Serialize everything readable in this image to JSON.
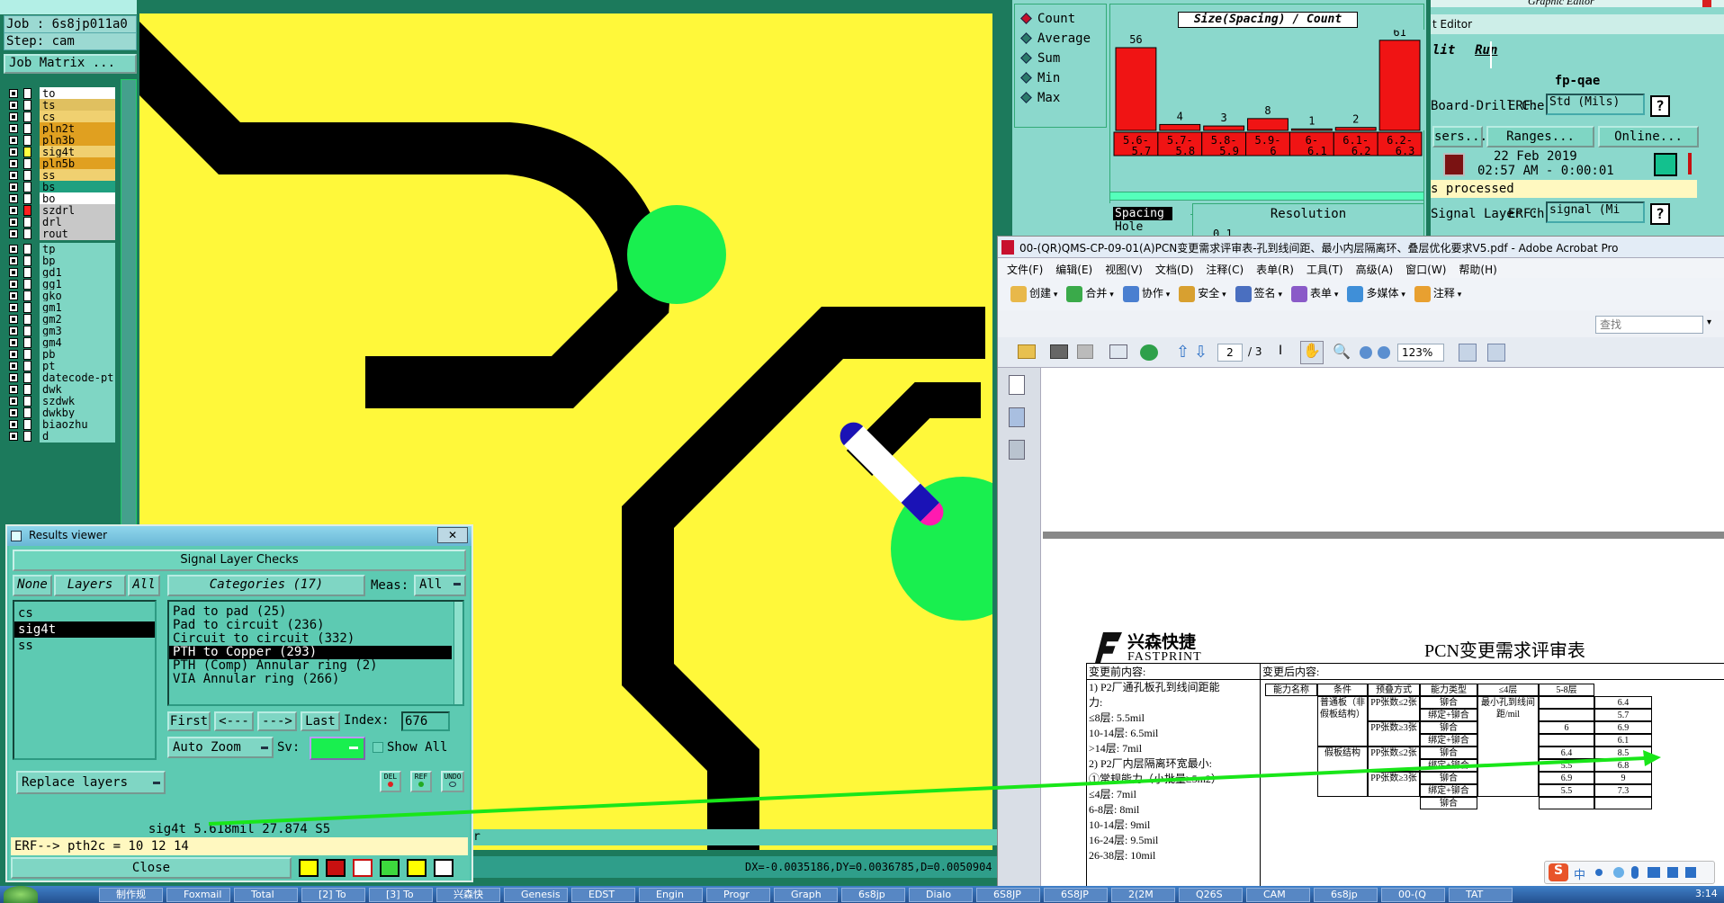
{
  "left": {
    "job": "Job : 6s8jp011a0",
    "step": "Step: cam",
    "matrix_button": "Job Matrix ...",
    "layers": [
      {
        "name": "to",
        "color": "#ffffff",
        "swatch": "#ffffff"
      },
      {
        "name": "ts",
        "color": "#e0c060",
        "swatch": "#ffffff"
      },
      {
        "name": "cs",
        "color": "#f0d070",
        "swatch": "#ffffff"
      },
      {
        "name": "pln2t",
        "color": "#e0a020",
        "swatch": "#ffffff"
      },
      {
        "name": "pln3b",
        "color": "#e0a020",
        "swatch": "#ffffff"
      },
      {
        "name": "sig4t",
        "color": "#f0d070",
        "swatch": "#ffff40"
      },
      {
        "name": "pln5b",
        "color": "#e0a020",
        "swatch": "#ffffff"
      },
      {
        "name": "ss",
        "color": "#f0d070",
        "swatch": "#ffffff"
      },
      {
        "name": "bs",
        "color": "#20a080",
        "swatch": "#ffffff"
      },
      {
        "name": "bo",
        "color": "#ffffff",
        "swatch": "#ffffff"
      },
      {
        "name": "szdrl",
        "color": "#c8c8c8",
        "swatch": "#ff2020"
      },
      {
        "name": "drl",
        "color": "#c8c8c8",
        "swatch": "#ffffff"
      },
      {
        "name": "rout",
        "color": "#c8c8c8",
        "swatch": "#ffffff"
      },
      {
        "name": "tp",
        "color": "#7fd6c4",
        "swatch": "#ffffff"
      },
      {
        "name": "bp",
        "color": "#7fd6c4",
        "swatch": "#ffffff"
      },
      {
        "name": "gd1",
        "color": "#7fd6c4",
        "swatch": "#ffffff"
      },
      {
        "name": "gg1",
        "color": "#7fd6c4",
        "swatch": "#ffffff"
      },
      {
        "name": "gko",
        "color": "#7fd6c4",
        "swatch": "#ffffff"
      },
      {
        "name": "gm1",
        "color": "#7fd6c4",
        "swatch": "#ffffff"
      },
      {
        "name": "gm2",
        "color": "#7fd6c4",
        "swatch": "#ffffff"
      },
      {
        "name": "gm3",
        "color": "#7fd6c4",
        "swatch": "#ffffff"
      },
      {
        "name": "gm4",
        "color": "#7fd6c4",
        "swatch": "#ffffff"
      },
      {
        "name": "pb",
        "color": "#7fd6c4",
        "swatch": "#ffffff"
      },
      {
        "name": "pt",
        "color": "#7fd6c4",
        "swatch": "#ffffff"
      },
      {
        "name": "datecode-pt",
        "color": "#7fd6c4",
        "swatch": "#ffffff"
      },
      {
        "name": "dwk",
        "color": "#7fd6c4",
        "swatch": "#ffffff"
      },
      {
        "name": "szdwk",
        "color": "#7fd6c4",
        "swatch": "#ffffff"
      },
      {
        "name": "dwkby",
        "color": "#7fd6c4",
        "swatch": "#ffffff"
      },
      {
        "name": "biaozhu",
        "color": "#7fd6c4",
        "swatch": "#ffffff"
      },
      {
        "name": "d",
        "color": "#7fd6c4",
        "swatch": "#ffffff"
      }
    ]
  },
  "histogram": {
    "modes": [
      "Count",
      "Average",
      "Sum",
      "Min",
      "Max"
    ],
    "selected_mode": "Count",
    "title": "Size(Spacing) / Count",
    "spacing_label": "Spacing",
    "hole_label": "Hole",
    "resolution_label": "Resolution",
    "resolution_value": "0.1"
  },
  "chart_data": {
    "type": "bar",
    "title": "Size(Spacing) / Count",
    "categories": [
      "5.6-5.7",
      "5.7-5.8",
      "5.8-5.9",
      "5.9-6",
      "6-6.1",
      "6.1-6.2",
      "6.2-6.3"
    ],
    "values": [
      56,
      4,
      3,
      8,
      1,
      2,
      61
    ],
    "ylim": [
      0,
      70
    ]
  },
  "editor": {
    "title": "t Editor",
    "graphic_editor": "Graphic Editor",
    "edit_label": "lit",
    "run_label": "Run",
    "fp": "fp-qae",
    "check1": "Board-Drill Che",
    "erf1": "ERF:",
    "erf1_value": "Std (Mils)",
    "help": "?",
    "users": "sers...",
    "ranges": "Ranges...",
    "online": "Online...",
    "date": "22 Feb 2019",
    "time": "02:57 AM - 0:00:01",
    "processed": "s processed",
    "check2": "Signal Layer Ch",
    "erf2": "ERF:",
    "erf2_value": "signal (Mi"
  },
  "acrobat": {
    "title": "00-(QR)QMS-CP-09-01(A)PCN变更需求评审表-孔到线间距、最小内层隔离环、叠层优化要求V5.pdf - Adobe Acrobat Pro",
    "menu": [
      "文件(F)",
      "编辑(E)",
      "视图(V)",
      "文档(D)",
      "注释(C)",
      "表单(R)",
      "工具(T)",
      "高级(A)",
      "窗口(W)",
      "帮助(H)"
    ],
    "toolbar": [
      "创建",
      "合并",
      "协作",
      "安全",
      "签名",
      "表单",
      "多媒体",
      "注释"
    ],
    "search_placeholder": "查找",
    "page_current": "2",
    "page_total": "/ 3",
    "zoom": "123%",
    "company_cn": "兴森快捷",
    "company_en": "FASTPRINT",
    "doc_title": "PCN变更需求评审表",
    "before_header": "变更前内容:",
    "after_header": "变更后内容:",
    "before_lines": [
      "1) P2厂通孔板孔到线间距能",
      "力:",
      "≤8层: 5.5mil",
      "10-14层: 6.5mil",
      ">14层: 7mil",
      "2) P2厂内层隔离环宽最小:",
      "①常规能力（小批量≥5m2）",
      "≤4层: 7mil",
      "6-8层: 8mil",
      "10-14层: 9mil",
      "16-24层: 9.5mil",
      "26-38层: 10mil"
    ],
    "table_headers": [
      "能力名称",
      "条件",
      "预叠方式",
      "能力类型",
      "≤4层",
      "5-8层"
    ],
    "cond_common": "普通板（非假板结构）",
    "cond_fake": "假板结构",
    "capability": "最小孔到线间距/mil",
    "pp_le2": "PP张数≤2张",
    "pp_ge3": "PP张数≥3张",
    "stack1": "铆合",
    "stack2": "绑定+铆合",
    "rows": [
      {
        "stack": "铆合",
        "le4": "",
        "v58": "6.4"
      },
      {
        "stack": "绑定+铆合",
        "le4": "",
        "v58": "5.7"
      },
      {
        "stack": "铆合",
        "le4": "6",
        "v58": "6.9"
      },
      {
        "stack": "绑定+铆合",
        "le4": "",
        "v58": "6.1"
      },
      {
        "stack": "铆合",
        "le4": "6.4",
        "v58": "8.5"
      },
      {
        "stack": "绑定+铆合",
        "le4": "5.5",
        "v58": "6.8"
      },
      {
        "stack": "铆合",
        "le4": "6.9",
        "v58": "9"
      },
      {
        "stack": "绑定+铆合",
        "le4": "5.5",
        "v58": "7.3"
      },
      {
        "stack": "铆合",
        "le4": "",
        "v58": ""
      }
    ]
  },
  "results": {
    "title": "Results viewer",
    "close_x": "✕",
    "header": "Signal Layer Checks",
    "none_btn": "None",
    "layers_btn": "Layers",
    "all_btn": "All",
    "categories_btn": "Categories (17)",
    "meas_label": "Meas:",
    "meas_value": "All",
    "layers": [
      "cs",
      "sig4t",
      "ss"
    ],
    "selected_layer": "sig4t",
    "categories": [
      "Pad to pad (25)",
      "Pad to circuit (236)",
      "Circuit to circuit (332)",
      "PTH to Copper (293)",
      "PTH (Comp) Annular ring (2)",
      "VIA Annular ring (266)"
    ],
    "selected_category": "PTH to Copper (293)",
    "first_btn": "First",
    "prev_btn": "<---",
    "next_btn": "--->",
    "last_btn": "Last",
    "index_label": "Index:",
    "index_value": "676",
    "auto_zoom": "Auto Zoom",
    "sv_label": "Sv:",
    "show_all": "Show All",
    "replace_layers": "Replace layers",
    "del_btn": "DEL",
    "ref_btn": "REF",
    "undo_btn": "UNDO",
    "status_line": "sig4t 5.618mil  27.874  S5",
    "erf_line": "ERF--> pth2c = 10 12 14",
    "close_btn": "Close"
  },
  "status": {
    "coords": "DX=-0.0035186,DY=0.0036785,D=0.0050904",
    "partial": "r"
  },
  "taskbar": {
    "items": [
      "制作规",
      "Foxmail",
      "Total",
      "[2] To",
      "[3] To",
      "兴森快",
      "Genesis",
      "EDST",
      "Engin",
      "Progr",
      "Graph",
      "6s8jp",
      "Dialo",
      "6S8JP",
      "6S8JP",
      "2(2M",
      "Q26S",
      "CAM",
      "6s8jp",
      "00-(Q",
      "TAT"
    ],
    "time": "3:14",
    "ime": "中"
  }
}
